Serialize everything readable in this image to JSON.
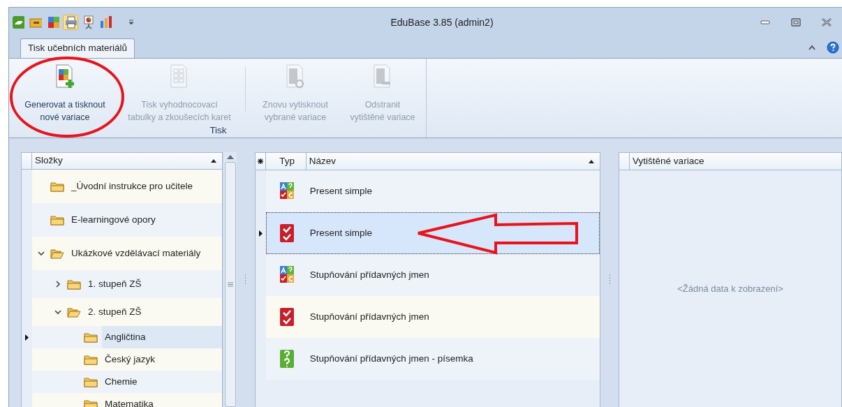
{
  "window": {
    "title": "EduBase 3.85 (admin2)"
  },
  "quick_access": [
    {
      "kind": "open",
      "selected": false
    },
    {
      "kind": "folder",
      "selected": false
    },
    {
      "kind": "variants",
      "selected": false
    },
    {
      "kind": "print",
      "selected": true
    },
    {
      "kind": "presentation",
      "selected": false
    },
    {
      "kind": "chart",
      "selected": false
    }
  ],
  "tabs": [
    {
      "label": "Tisk učebních materiálů",
      "selected": true
    }
  ],
  "ribbon": {
    "group_label": "Tisk",
    "buttons": [
      {
        "kind": "generate",
        "label": [
          "Generovat a tisknout",
          "nové variace"
        ],
        "disabled": false
      },
      {
        "kind": "sheet",
        "label": [
          "Tisk vyhodnocovací",
          "tabulky a zkoušecích karet"
        ],
        "disabled": true
      },
      {
        "kind": "reprint",
        "label": [
          "Znovu vytisknout",
          "vybrané variace"
        ],
        "disabled": true
      },
      {
        "kind": "remove",
        "label": [
          "Odstranit",
          "vytištěné variace"
        ],
        "disabled": true
      }
    ]
  },
  "folders": {
    "header": "Složky",
    "items": [
      {
        "label": "_Úvodní instrukce pro učitele",
        "selected": false
      },
      {
        "label": "E-learningové opory",
        "selected": false
      },
      {
        "label": "Ukázkové vzdělávací materiály",
        "selected": false,
        "expanded": true,
        "children": [
          {
            "label": "1. stupeň ZŠ",
            "selected": false,
            "expanded": false
          },
          {
            "label": "2. stupeň ZŠ",
            "selected": false,
            "expanded": true,
            "children": [
              {
                "label": "Angličtina",
                "selected": true
              },
              {
                "label": "Český jazyk",
                "selected": false
              },
              {
                "label": "Chemie",
                "selected": false
              },
              {
                "label": "Matematika",
                "selected": false
              }
            ]
          }
        ]
      }
    ]
  },
  "variants": {
    "columns": [
      "Typ",
      "Název"
    ],
    "rows": [
      {
        "kind": "combined",
        "name": "Present simple",
        "selected": false
      },
      {
        "kind": "test",
        "name": "Present simple",
        "selected": true
      },
      {
        "kind": "combined",
        "name": "Stupňování přídavných jmen",
        "selected": false
      },
      {
        "kind": "test",
        "name": "Stupňování přídavných jmen",
        "selected": false
      },
      {
        "kind": "written",
        "name": "Stupňování přídavných jmen - písemka",
        "selected": false
      }
    ]
  },
  "printed": {
    "header": "Vytištěné variace",
    "empty_text": "<Žádná data k zobrazení>"
  }
}
